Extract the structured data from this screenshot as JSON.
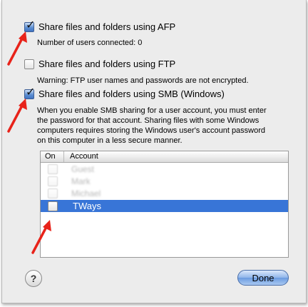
{
  "options": {
    "afp": {
      "label": "Share files and folders using AFP",
      "checked": true,
      "info": "Number of users connected: 0"
    },
    "ftp": {
      "label": "Share files and folders using FTP",
      "checked": false,
      "info": "Warning: FTP user names and passwords are not encrypted."
    },
    "smb": {
      "label": "Share files and folders using SMB (Windows)",
      "checked": true,
      "info": "When you enable SMB sharing for a user account, you must enter the password for that account. Sharing files with some Windows computers requires storing the Windows user's account password on this computer in a less secure manner."
    }
  },
  "accounts_table": {
    "col_on": "On",
    "col_account": "Account",
    "rows": [
      {
        "account": "Guest",
        "on": false,
        "blurred": true
      },
      {
        "account": "Mark",
        "on": false,
        "blurred": true
      },
      {
        "account": "Michael",
        "on": false,
        "blurred": true
      },
      {
        "account": "TWays",
        "on": false,
        "selected": true
      }
    ]
  },
  "buttons": {
    "help": "?",
    "done": "Done"
  },
  "colors": {
    "selection": "#3875d7",
    "arrow": "#e8231a",
    "accent": "#5d8fd2"
  }
}
